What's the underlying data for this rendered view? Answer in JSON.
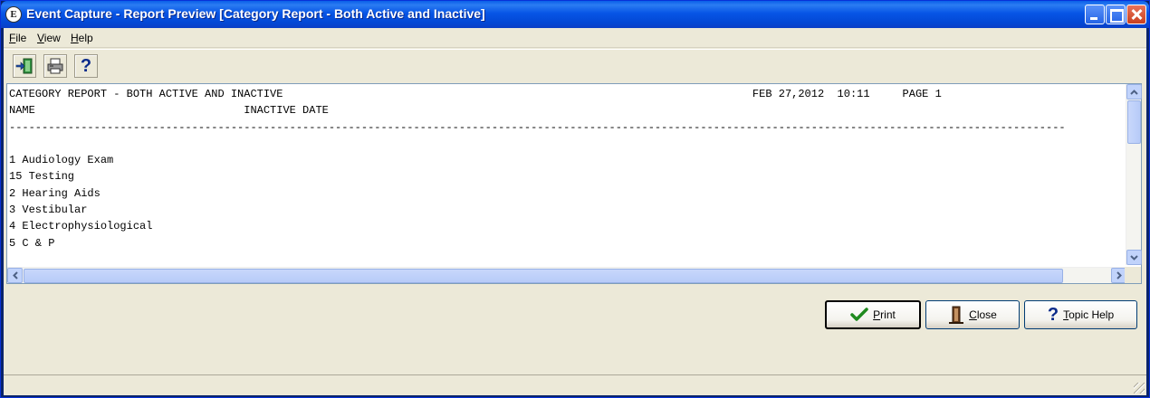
{
  "window": {
    "title": "Event Capture - Report Preview [Category Report - Both Active and Inactive]",
    "icon_glyph": "E"
  },
  "menu": [
    {
      "label": "File",
      "mnemonic": "F",
      "rest": "ile"
    },
    {
      "label": "View",
      "mnemonic": "V",
      "rest": "iew"
    },
    {
      "label": "Help",
      "mnemonic": "H",
      "rest": "elp"
    }
  ],
  "toolbar": {
    "buttons": [
      {
        "name": "exit-button",
        "icon": "exit-door-icon"
      },
      {
        "name": "print-toolbar-button",
        "icon": "printer-icon"
      },
      {
        "name": "help-toolbar-button",
        "icon": "question-mark-icon",
        "glyph": "?"
      }
    ]
  },
  "report": {
    "header_line_1": "CATEGORY REPORT - BOTH ACTIVE AND INACTIVE                                                                        FEB 27,2012  10:11     PAGE 1",
    "header_line_2": "NAME                                INACTIVE DATE",
    "separator": "------------------------------------------------------------------------------------------------------------------------------------------------------------------",
    "blank": "",
    "rows": [
      "1 Audiology Exam",
      "15 Testing",
      "2 Hearing Aids",
      "3 Vestibular",
      "4 Electrophysiological",
      "5 C & P"
    ]
  },
  "buttons": {
    "print": {
      "label": "Print",
      "mnemonic": "P",
      "rest": "rint",
      "icon": "checkmark-icon",
      "color": "#1f8a1f"
    },
    "close": {
      "label": "Close",
      "mnemonic": "C",
      "rest": "lose",
      "icon": "door-exit-icon"
    },
    "topic_help": {
      "label": "Topic Help",
      "mnemonic": "T",
      "rest": "opic Help",
      "icon": "question-mark-icon",
      "glyph": "?"
    }
  },
  "colors": {
    "titlebar": "#0055e5",
    "dialog_bg": "#ece9d8",
    "scroll_thumb": "#c1d3fb"
  }
}
